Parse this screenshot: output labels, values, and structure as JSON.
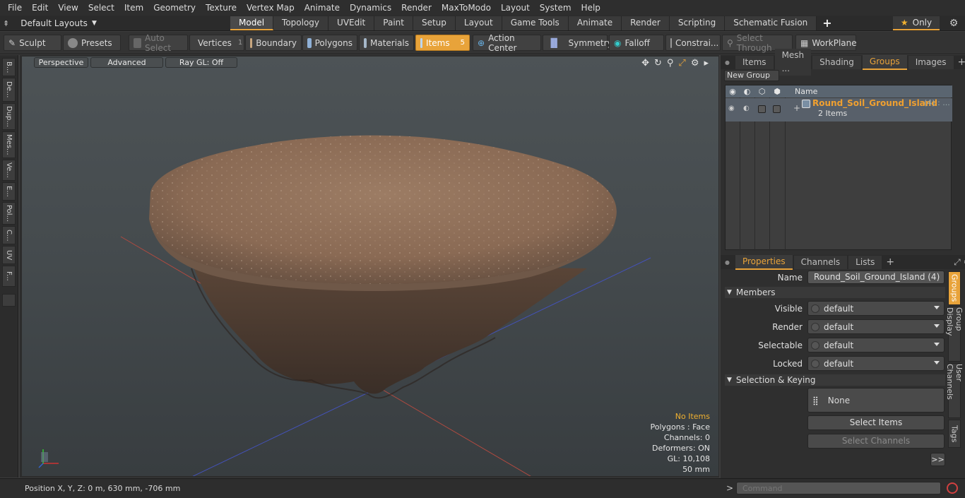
{
  "menu": [
    "File",
    "Edit",
    "View",
    "Select",
    "Item",
    "Geometry",
    "Texture",
    "Vertex Map",
    "Animate",
    "Dynamics",
    "Render",
    "MaxToModo",
    "Layout",
    "System",
    "Help"
  ],
  "layout_selector": "Default Layouts",
  "mode_tabs": [
    "Model",
    "Topology",
    "UVEdit",
    "Paint",
    "Setup",
    "Layout",
    "Game Tools",
    "Animate",
    "Render",
    "Scripting",
    "Schematic Fusion"
  ],
  "active_mode_tab": "Model",
  "only_label": "Only",
  "toolbar": {
    "sculpt": "Sculpt",
    "presets": "Presets",
    "auto_select": "Auto Select",
    "vertices": "Vertices",
    "vertices_count": "1",
    "boundary": "Boundary",
    "polygons": "Polygons",
    "materials": "Materials",
    "items": "Items",
    "items_count": "5",
    "action_center": "Action Center",
    "symmetry": "Symmetry",
    "falloff": "Falloff",
    "constraints": "Constrai...",
    "select_through": "Select Through",
    "workplane": "WorkPlane"
  },
  "left_tools": [
    "B...",
    "De...",
    "Dup...",
    "Mes...",
    "Ve...",
    "E...",
    "Pol...",
    "C...",
    "UV",
    "F..."
  ],
  "viewport": {
    "view_mode": "Perspective",
    "shading": "Advanced",
    "raygl": "Ray GL: Off",
    "info": {
      "items": "No Items",
      "polygons": "Polygons : Face",
      "channels": "Channels: 0",
      "deformers": "Deformers: ON",
      "gl": "GL: 10,108",
      "scale": "50 mm"
    }
  },
  "status": {
    "position": "Position X, Y, Z:  0 m, 630 mm, -706 mm"
  },
  "colors": {
    "accent": "#e8a33a",
    "warn": "#f0b030"
  },
  "top_panel": {
    "tabs": [
      "Items",
      "Mesh ...",
      "Shading",
      "Groups",
      "Images"
    ],
    "active": "Groups",
    "new_group": "New Group",
    "name_header": "Name",
    "group": {
      "name": "Round_Soil_Ground_Island",
      "suffix": "(4) : ...",
      "items": "2 Items"
    }
  },
  "props_panel": {
    "tabs": [
      "Properties",
      "Channels",
      "Lists"
    ],
    "active": "Properties",
    "name_label": "Name",
    "name_value": "Round_Soil_Ground_Island (4)",
    "members": "Members",
    "fields": [
      {
        "label": "Visible",
        "value": "default"
      },
      {
        "label": "Render",
        "value": "default"
      },
      {
        "label": "Selectable",
        "value": "default"
      },
      {
        "label": "Locked",
        "value": "default"
      }
    ],
    "selection_keying": "Selection & Keying",
    "none_label": "None",
    "select_items": "Select Items",
    "select_channels": "Select Channels",
    "more": ">>",
    "side_tabs": [
      "Groups",
      "Group Display",
      "User Channels",
      "Tags"
    ]
  },
  "command_placeholder": "Command"
}
